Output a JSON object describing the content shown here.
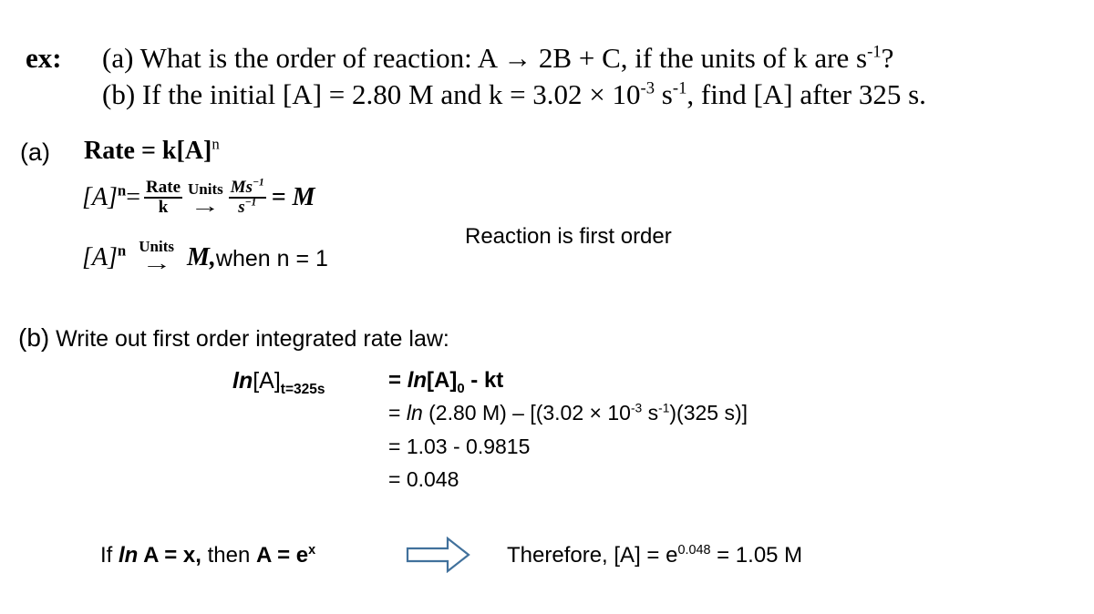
{
  "header": {
    "ex_label": "ex:",
    "question_a": "(a) What is the order of reaction: A → 2B + C, if the units of k are s",
    "question_a_exp": "-1",
    "question_a_end": "?",
    "question_b_pre": "(b) If the initial [A] = 2.80 M and k = 3.02 × 10",
    "question_b_exp1": "-3",
    "question_b_mid": " s",
    "question_b_exp2": "-1",
    "question_b_end": ", find [A] after 325 s."
  },
  "part_a": {
    "label": "(a)",
    "rate_eq": "Rate = k[A]",
    "rate_exp": "n",
    "line2_lhs": "[A]",
    "line2_lhs_exp": "n",
    "line2_eq": "=",
    "frac1_num": "Rate",
    "frac1_den": "k",
    "arrow_label": "Units",
    "frac2_num": "Ms",
    "frac2_num_exp": "−1",
    "frac2_den": "s",
    "frac2_den_exp": "−1",
    "line2_result": "= M",
    "line3_lhs": "[A]",
    "line3_lhs_exp": "n",
    "line3_arrow_label": "Units",
    "line3_result_m": "M,",
    "line3_result_text": " when n = 1",
    "conclusion": "Reaction is first order"
  },
  "part_b": {
    "label": "(b)",
    "heading": " Write out first order integrated rate law:",
    "lhs_ln": "ln",
    "lhs_a": "[A]",
    "lhs_sub": "t=325s",
    "step1_eq": "= ",
    "step1_ln": "ln",
    "step1_a": "[A]",
    "step1_sub": "0",
    "step1_end": " - kt",
    "step2_pre": "= ",
    "step2_ln": "ln",
    "step2_mid": " (2.80 M) – [(3.02 × 10",
    "step2_exp1": "-3",
    "step2_s": " s",
    "step2_exp2": "-1",
    "step2_end": ")(325 s)]",
    "step3": "= 1.03 - 0.9815",
    "step4": "= 0.048"
  },
  "footer": {
    "if_text": "If ",
    "if_ln": "ln",
    "if_eq": " A = x,",
    "then_text": " then ",
    "then_eq": "A = e",
    "then_exp": "x",
    "arrow_icon": "block-right-arrow",
    "arrow_color": "#41719C",
    "therefore_pre": "Therefore, [A] = e",
    "therefore_exp": "0.048",
    "therefore_end": " = 1.05 M"
  }
}
